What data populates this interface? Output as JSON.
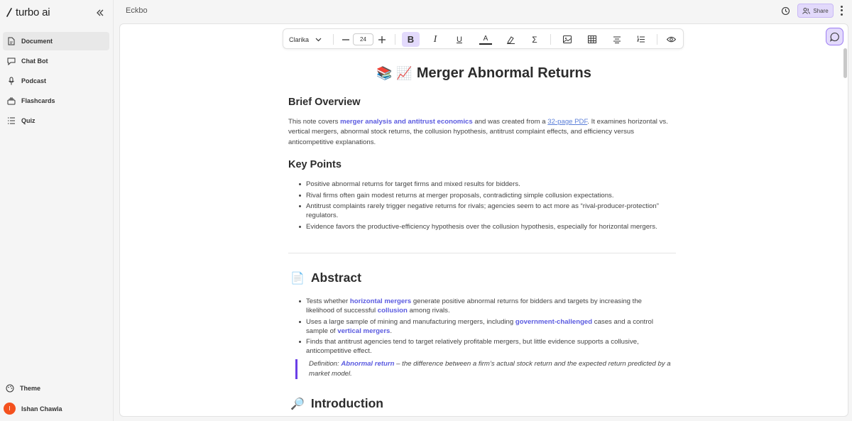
{
  "app": {
    "brand": "turbo ai",
    "workspace_title": "Eckbo"
  },
  "sidebar": {
    "items": [
      {
        "label": "Document",
        "icon": "document-icon",
        "active": true
      },
      {
        "label": "Chat Bot",
        "icon": "chat-icon",
        "active": false
      },
      {
        "label": "Podcast",
        "icon": "microphone-icon",
        "active": false
      },
      {
        "label": "Flashcards",
        "icon": "flashcards-icon",
        "active": false
      },
      {
        "label": "Quiz",
        "icon": "quiz-list-icon",
        "active": false
      }
    ],
    "theme_label": "Theme",
    "user": {
      "name": "Ishan Chawla",
      "initial": "I"
    }
  },
  "header": {
    "share_label": "Share"
  },
  "toolbar": {
    "font": "Clarika",
    "font_size": "24",
    "bold": "B",
    "italic": "I",
    "underline": "U",
    "color": "A"
  },
  "colors": {
    "accent": "#6a3fe6",
    "accent_light": "#e3dafc",
    "highlight_text": "#5a5ae0",
    "avatar": "#f4511e"
  },
  "document": {
    "title": "Merger Abnormal Returns",
    "title_emojis": [
      "📚",
      "📈"
    ],
    "brief_overview": {
      "heading": "Brief Overview",
      "p1": "This note covers ",
      "hl1": "merger analysis and antitrust economics",
      "p2": " and was created from a ",
      "link": "32-page PDF",
      "p3": ". It examines horizontal vs. vertical mergers, abnormal stock returns, the collusion hypothesis, antitrust complaint effects, and efficiency versus anticompetitive explanations."
    },
    "key_points": {
      "heading": "Key Points",
      "items": [
        "Positive abnormal returns for target firms and mixed results for bidders.",
        "Rival firms often gain modest returns at merger proposals, contradicting simple collusion expectations.",
        "Antitrust complaints rarely trigger negative returns for rivals; agencies seem to act more as “rival-producer-protection” regulators.",
        "Evidence favors the productive-efficiency hypothesis over the collusion hypothesis, especially for horizontal mergers."
      ]
    },
    "abstract": {
      "heading": "Abstract",
      "emoji": "📄",
      "b1": {
        "a": "Tests whether ",
        "hl": "horizontal mergers",
        "b": " generate positive abnormal returns for bidders and targets by increasing the likelihood of successful ",
        "hl2": "collusion",
        "c": " among rivals."
      },
      "b2": {
        "a": "Uses a large sample of mining and manufacturing mergers, including ",
        "hl": "government-challenged",
        "b": " cases and a control sample of ",
        "hl2": "vertical mergers",
        "c": "."
      },
      "b3": "Finds that antitrust agencies tend to target relatively profitable mergers, but little evidence supports a collusive, anticompetitive effect.",
      "definition": {
        "prefix": "Definition: ",
        "term": "Abnormal return",
        "text": " – the difference between a firm’s actual stock return and the expected return predicted by a market model."
      }
    },
    "introduction": {
      "heading": "Introduction",
      "emoji": "🔎"
    }
  }
}
